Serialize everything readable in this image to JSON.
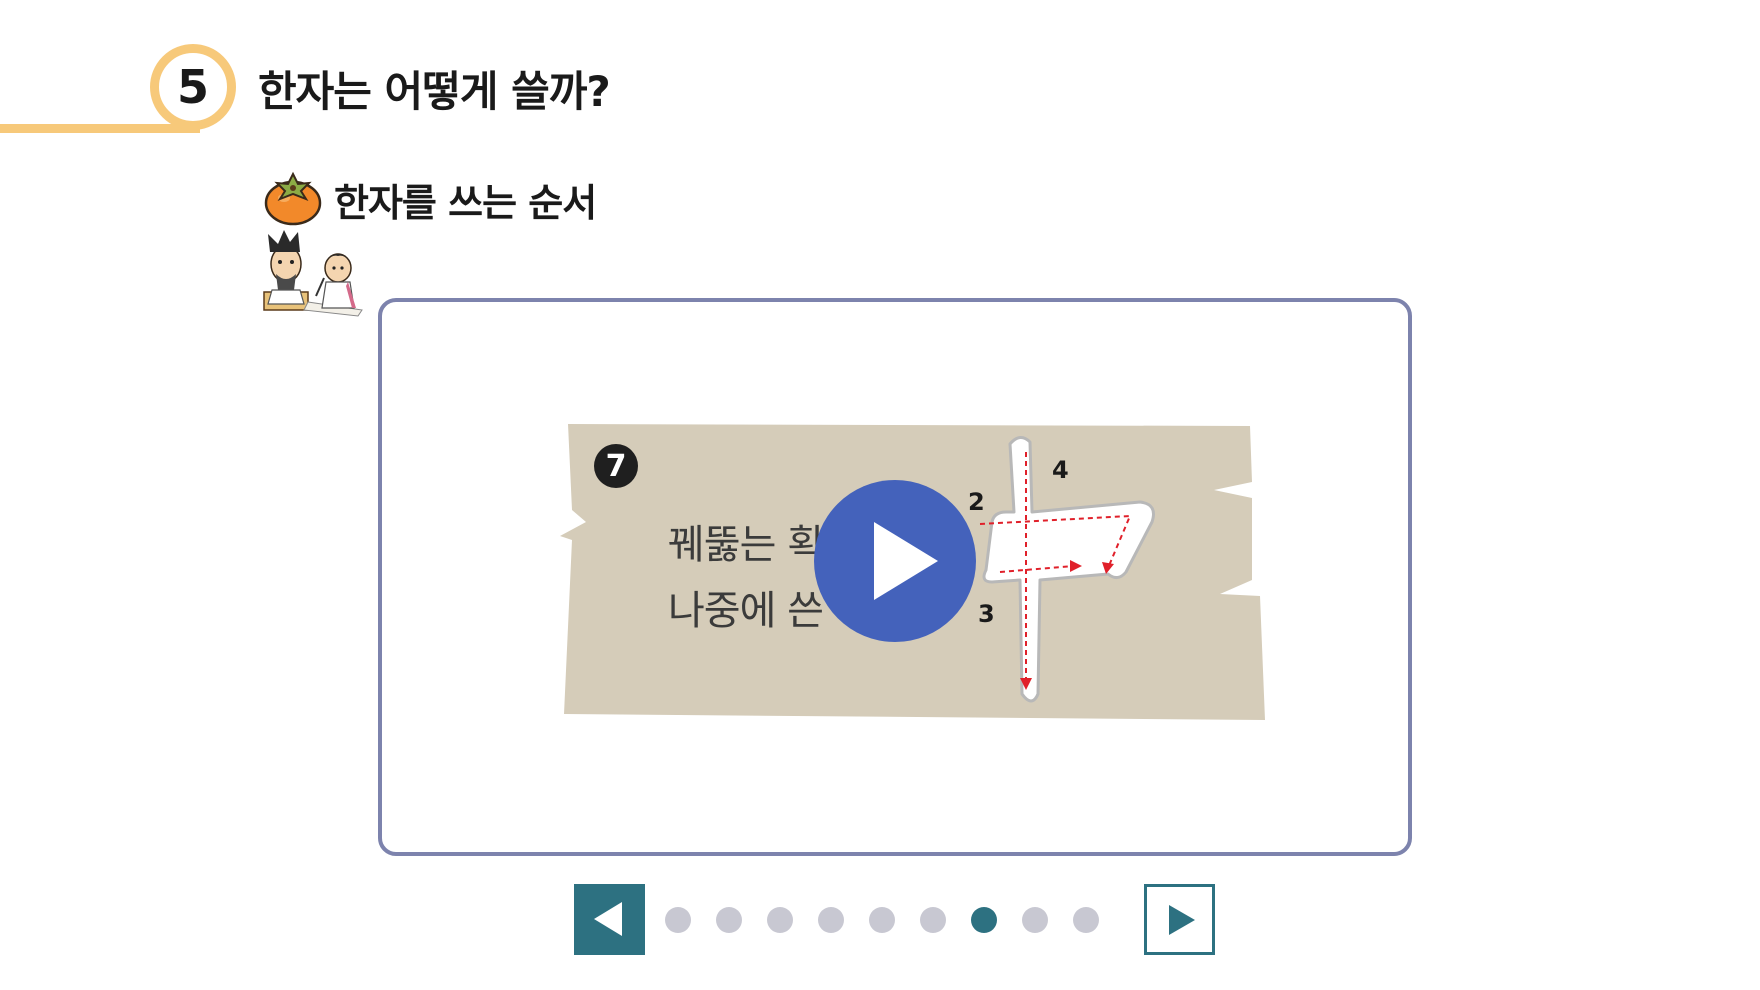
{
  "header": {
    "section_number": "5",
    "title": "한자는 어떻게 쓸까?"
  },
  "subheader": {
    "title": "한자를 쓰는 순서"
  },
  "card": {
    "step_number": "7",
    "text_line1": "꿰뚫는 획",
    "text_line2": "나중에 쓴",
    "hanzi_char": "中",
    "stroke_labels": [
      "2",
      "3",
      "4"
    ]
  },
  "pager": {
    "total": 9,
    "active_index": 6
  },
  "colors": {
    "accent_header": "#f7c97a",
    "frame_border": "#7d83ad",
    "board": "#d5ccb9",
    "play_button": "#4462bb",
    "nav_active": "#2d7181",
    "dot_inactive": "#c8c8d2",
    "stroke_guide": "#e0202a"
  },
  "icons": {
    "header_badge": "circle-number",
    "subheader": "persimmon-icon",
    "mascot": "scholar-characters-illustration",
    "play": "play-icon",
    "prev": "triangle-left-icon",
    "next": "triangle-right-icon"
  }
}
